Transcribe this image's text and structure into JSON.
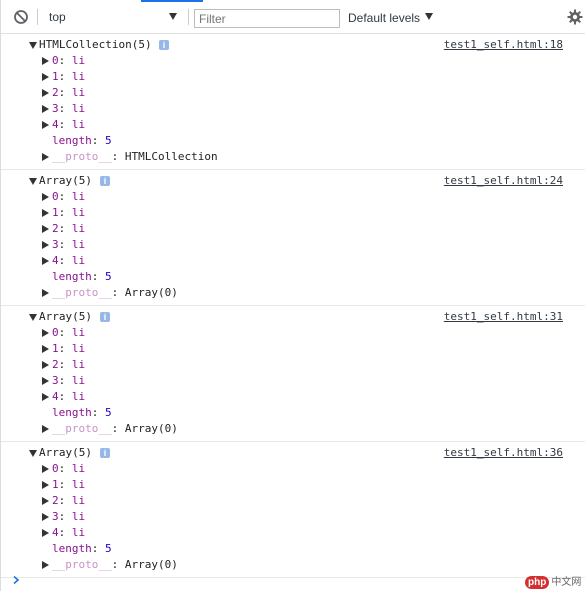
{
  "toolbar": {
    "context_label": "top",
    "filter_placeholder": "Filter",
    "levels_label": "Default levels"
  },
  "messages": [
    {
      "header": "HTMLCollection(5)",
      "source": "test1_self.html:18",
      "items": [
        {
          "key": "0",
          "value": "li"
        },
        {
          "key": "1",
          "value": "li"
        },
        {
          "key": "2",
          "value": "li"
        },
        {
          "key": "3",
          "value": "li"
        },
        {
          "key": "4",
          "value": "li"
        }
      ],
      "length_key": "length",
      "length_value": "5",
      "proto_key": "__proto__",
      "proto_value": "HTMLCollection"
    },
    {
      "header": "Array(5)",
      "source": "test1_self.html:24",
      "items": [
        {
          "key": "0",
          "value": "li"
        },
        {
          "key": "1",
          "value": "li"
        },
        {
          "key": "2",
          "value": "li"
        },
        {
          "key": "3",
          "value": "li"
        },
        {
          "key": "4",
          "value": "li"
        }
      ],
      "length_key": "length",
      "length_value": "5",
      "proto_key": "__proto__",
      "proto_value": "Array(0)"
    },
    {
      "header": "Array(5)",
      "source": "test1_self.html:31",
      "items": [
        {
          "key": "0",
          "value": "li"
        },
        {
          "key": "1",
          "value": "li"
        },
        {
          "key": "2",
          "value": "li"
        },
        {
          "key": "3",
          "value": "li"
        },
        {
          "key": "4",
          "value": "li"
        }
      ],
      "length_key": "length",
      "length_value": "5",
      "proto_key": "__proto__",
      "proto_value": "Array(0)"
    },
    {
      "header": "Array(5)",
      "source": "test1_self.html:36",
      "items": [
        {
          "key": "0",
          "value": "li"
        },
        {
          "key": "1",
          "value": "li"
        },
        {
          "key": "2",
          "value": "li"
        },
        {
          "key": "3",
          "value": "li"
        },
        {
          "key": "4",
          "value": "li"
        }
      ],
      "length_key": "length",
      "length_value": "5",
      "proto_key": "__proto__",
      "proto_value": "Array(0)"
    }
  ],
  "info_badge": "i",
  "watermark": {
    "brand": "php",
    "site": "中文网"
  },
  "icons": {
    "clear": "clear-console-icon",
    "gear": "gear-icon",
    "prompt": "prompt-chevron-icon",
    "info": "info-icon"
  },
  "colors": {
    "key_purple": "#881391",
    "number_blue": "#1c00cf",
    "proto_faded": "#c795c9",
    "toolbar_accent": "#1a73e8",
    "prompt_blue": "#1a73e8"
  }
}
